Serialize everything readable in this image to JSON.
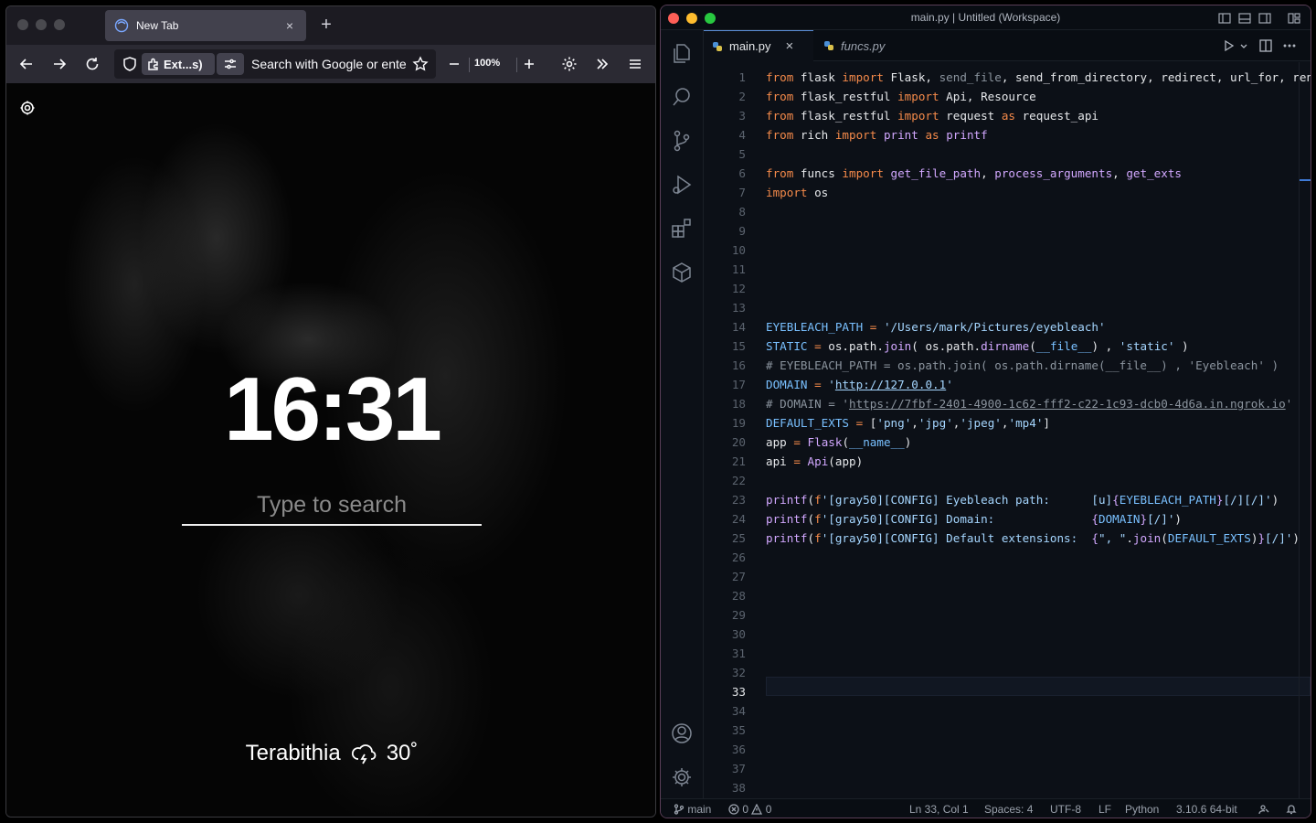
{
  "browser": {
    "tab": {
      "title": "New Tab",
      "close": "×"
    },
    "new_tab": "+",
    "extension_label": "Ext...s)",
    "urlbar_placeholder": "Search with Google or ente",
    "zoom": "100%",
    "clock": "16:31",
    "search_placeholder": "Type to search",
    "weather": {
      "location": "Terabithia",
      "temperature": "30˚",
      "icon": "cloud-lightning-icon"
    }
  },
  "vscode": {
    "title": "main.py | Untitled (Workspace)",
    "traffic_colors": [
      "#fe5f57",
      "#febc2e",
      "#28c840"
    ],
    "tabs": [
      {
        "label": "main.py",
        "active": true,
        "close": "×"
      },
      {
        "label": "funcs.py",
        "active": false
      }
    ],
    "cursor_line": 33,
    "lines": [
      {
        "n": "1",
        "code": "<span class=\"kw\">from</span> flask <span class=\"kw\">import</span> Flask, <span class=\"cm\">send_file</span>, send_from_directory, redirect, url_for, render_te"
      },
      {
        "n": "2",
        "code": "<span class=\"kw\">from</span> flask_restful <span class=\"kw\">import</span> Api, Resource"
      },
      {
        "n": "3",
        "code": "<span class=\"kw\">from</span> flask_restful <span class=\"kw\">import</span> request <span class=\"kw\">as</span> request_api"
      },
      {
        "n": "4",
        "code": "<span class=\"kw\">from</span> rich <span class=\"kw\">import</span> <span class=\"fn\">print</span> <span class=\"kw\">as</span> <span class=\"fn\">printf</span>"
      },
      {
        "n": "5",
        "code": ""
      },
      {
        "n": "6",
        "code": "<span class=\"kw\">from</span> funcs <span class=\"kw\">import</span> <span class=\"fn\">get_file_path</span>, <span class=\"fn\">process_arguments</span>, <span class=\"fn\">get_exts</span>"
      },
      {
        "n": "7",
        "code": "<span class=\"kw\">import</span> os"
      },
      {
        "n": "8",
        "code": ""
      },
      {
        "n": "9",
        "code": ""
      },
      {
        "n": "10",
        "code": ""
      },
      {
        "n": "11",
        "code": ""
      },
      {
        "n": "12",
        "code": ""
      },
      {
        "n": "13",
        "code": ""
      },
      {
        "n": "14",
        "code": "<span class=\"var\">EYEBLEACH_PATH</span> <span class=\"kw\">=</span> <span class=\"str\">'/Users/mark/Pictures/eyebleach'</span>"
      },
      {
        "n": "15",
        "code": "<span class=\"var\">STATIC</span> <span class=\"kw\">=</span> os.path.<span class=\"fn\">join</span>( os.path.<span class=\"fn\">dirname</span>(<span class=\"var\">__file__</span>) , <span class=\"str\">'static'</span> )"
      },
      {
        "n": "16",
        "code": "<span class=\"cm\"># EYEBLEACH_PATH = os.path.join( os.path.dirname(__file__) , 'Eyebleach' )</span>"
      },
      {
        "n": "17",
        "code": "<span class=\"var\">DOMAIN</span> <span class=\"kw\">=</span> <span class=\"str\">'<u>http://127.0.0.1</u>'</span>"
      },
      {
        "n": "18",
        "code": "<span class=\"cm\"># DOMAIN = '<u>https://7fbf-2401-4900-1c62-fff2-c22-1c93-dcb0-4d6a.in.ngrok.io</u>'</span>"
      },
      {
        "n": "19",
        "code": "<span class=\"var\">DEFAULT_EXTS</span> <span class=\"kw\">=</span> [<span class=\"str\">'png'</span>,<span class=\"str\">'jpg'</span>,<span class=\"str\">'jpeg'</span>,<span class=\"str\">'mp4'</span>]"
      },
      {
        "n": "20",
        "code": "app <span class=\"kw\">=</span> <span class=\"fn\">Flask</span>(<span class=\"var\">__name__</span>)"
      },
      {
        "n": "21",
        "code": "api <span class=\"kw\">=</span> <span class=\"fn\">Api</span>(app)"
      },
      {
        "n": "22",
        "code": ""
      },
      {
        "n": "23",
        "code": "<span class=\"fn\">printf</span>(<span class=\"kw\">f</span><span class=\"str\">'[gray50][CONFIG] Eyebleach path:      [u]</span><span class=\"fn\">{</span><span class=\"var\">EYEBLEACH_PATH</span><span class=\"fn\">}</span><span class=\"str\">[/][/]'</span>)"
      },
      {
        "n": "24",
        "code": "<span class=\"fn\">printf</span>(<span class=\"kw\">f</span><span class=\"str\">'[gray50][CONFIG] Domain:              </span><span class=\"fn\">{</span><span class=\"var\">DOMAIN</span><span class=\"fn\">}</span><span class=\"str\">[/]'</span>)"
      },
      {
        "n": "25",
        "code": "<span class=\"fn\">printf</span>(<span class=\"kw\">f</span><span class=\"str\">'[gray50][CONFIG] Default extensions:  </span><span class=\"fn\">{</span><span class=\"str\">\", \"</span>.<span class=\"fn\">join</span>(<span class=\"var\">DEFAULT_EXTS</span>)<span class=\"fn\">}</span><span class=\"str\">[/]'</span>)"
      },
      {
        "n": "26",
        "code": ""
      },
      {
        "n": "27",
        "code": ""
      },
      {
        "n": "28",
        "code": ""
      },
      {
        "n": "29",
        "code": ""
      },
      {
        "n": "30",
        "code": ""
      },
      {
        "n": "31",
        "code": ""
      },
      {
        "n": "32",
        "code": ""
      },
      {
        "n": "33",
        "code": ""
      },
      {
        "n": "34",
        "code": ""
      },
      {
        "n": "35",
        "code": ""
      },
      {
        "n": "36",
        "code": ""
      },
      {
        "n": "37",
        "code": ""
      },
      {
        "n": "38",
        "code": ""
      }
    ],
    "status": {
      "branch": "main",
      "errors": "0",
      "warnings": "0",
      "position": "Ln 33, Col 1",
      "spaces": "Spaces: 4",
      "encoding": "UTF-8",
      "eol": "LF",
      "language": "Python",
      "interpreter": "3.10.6 64-bit"
    }
  }
}
